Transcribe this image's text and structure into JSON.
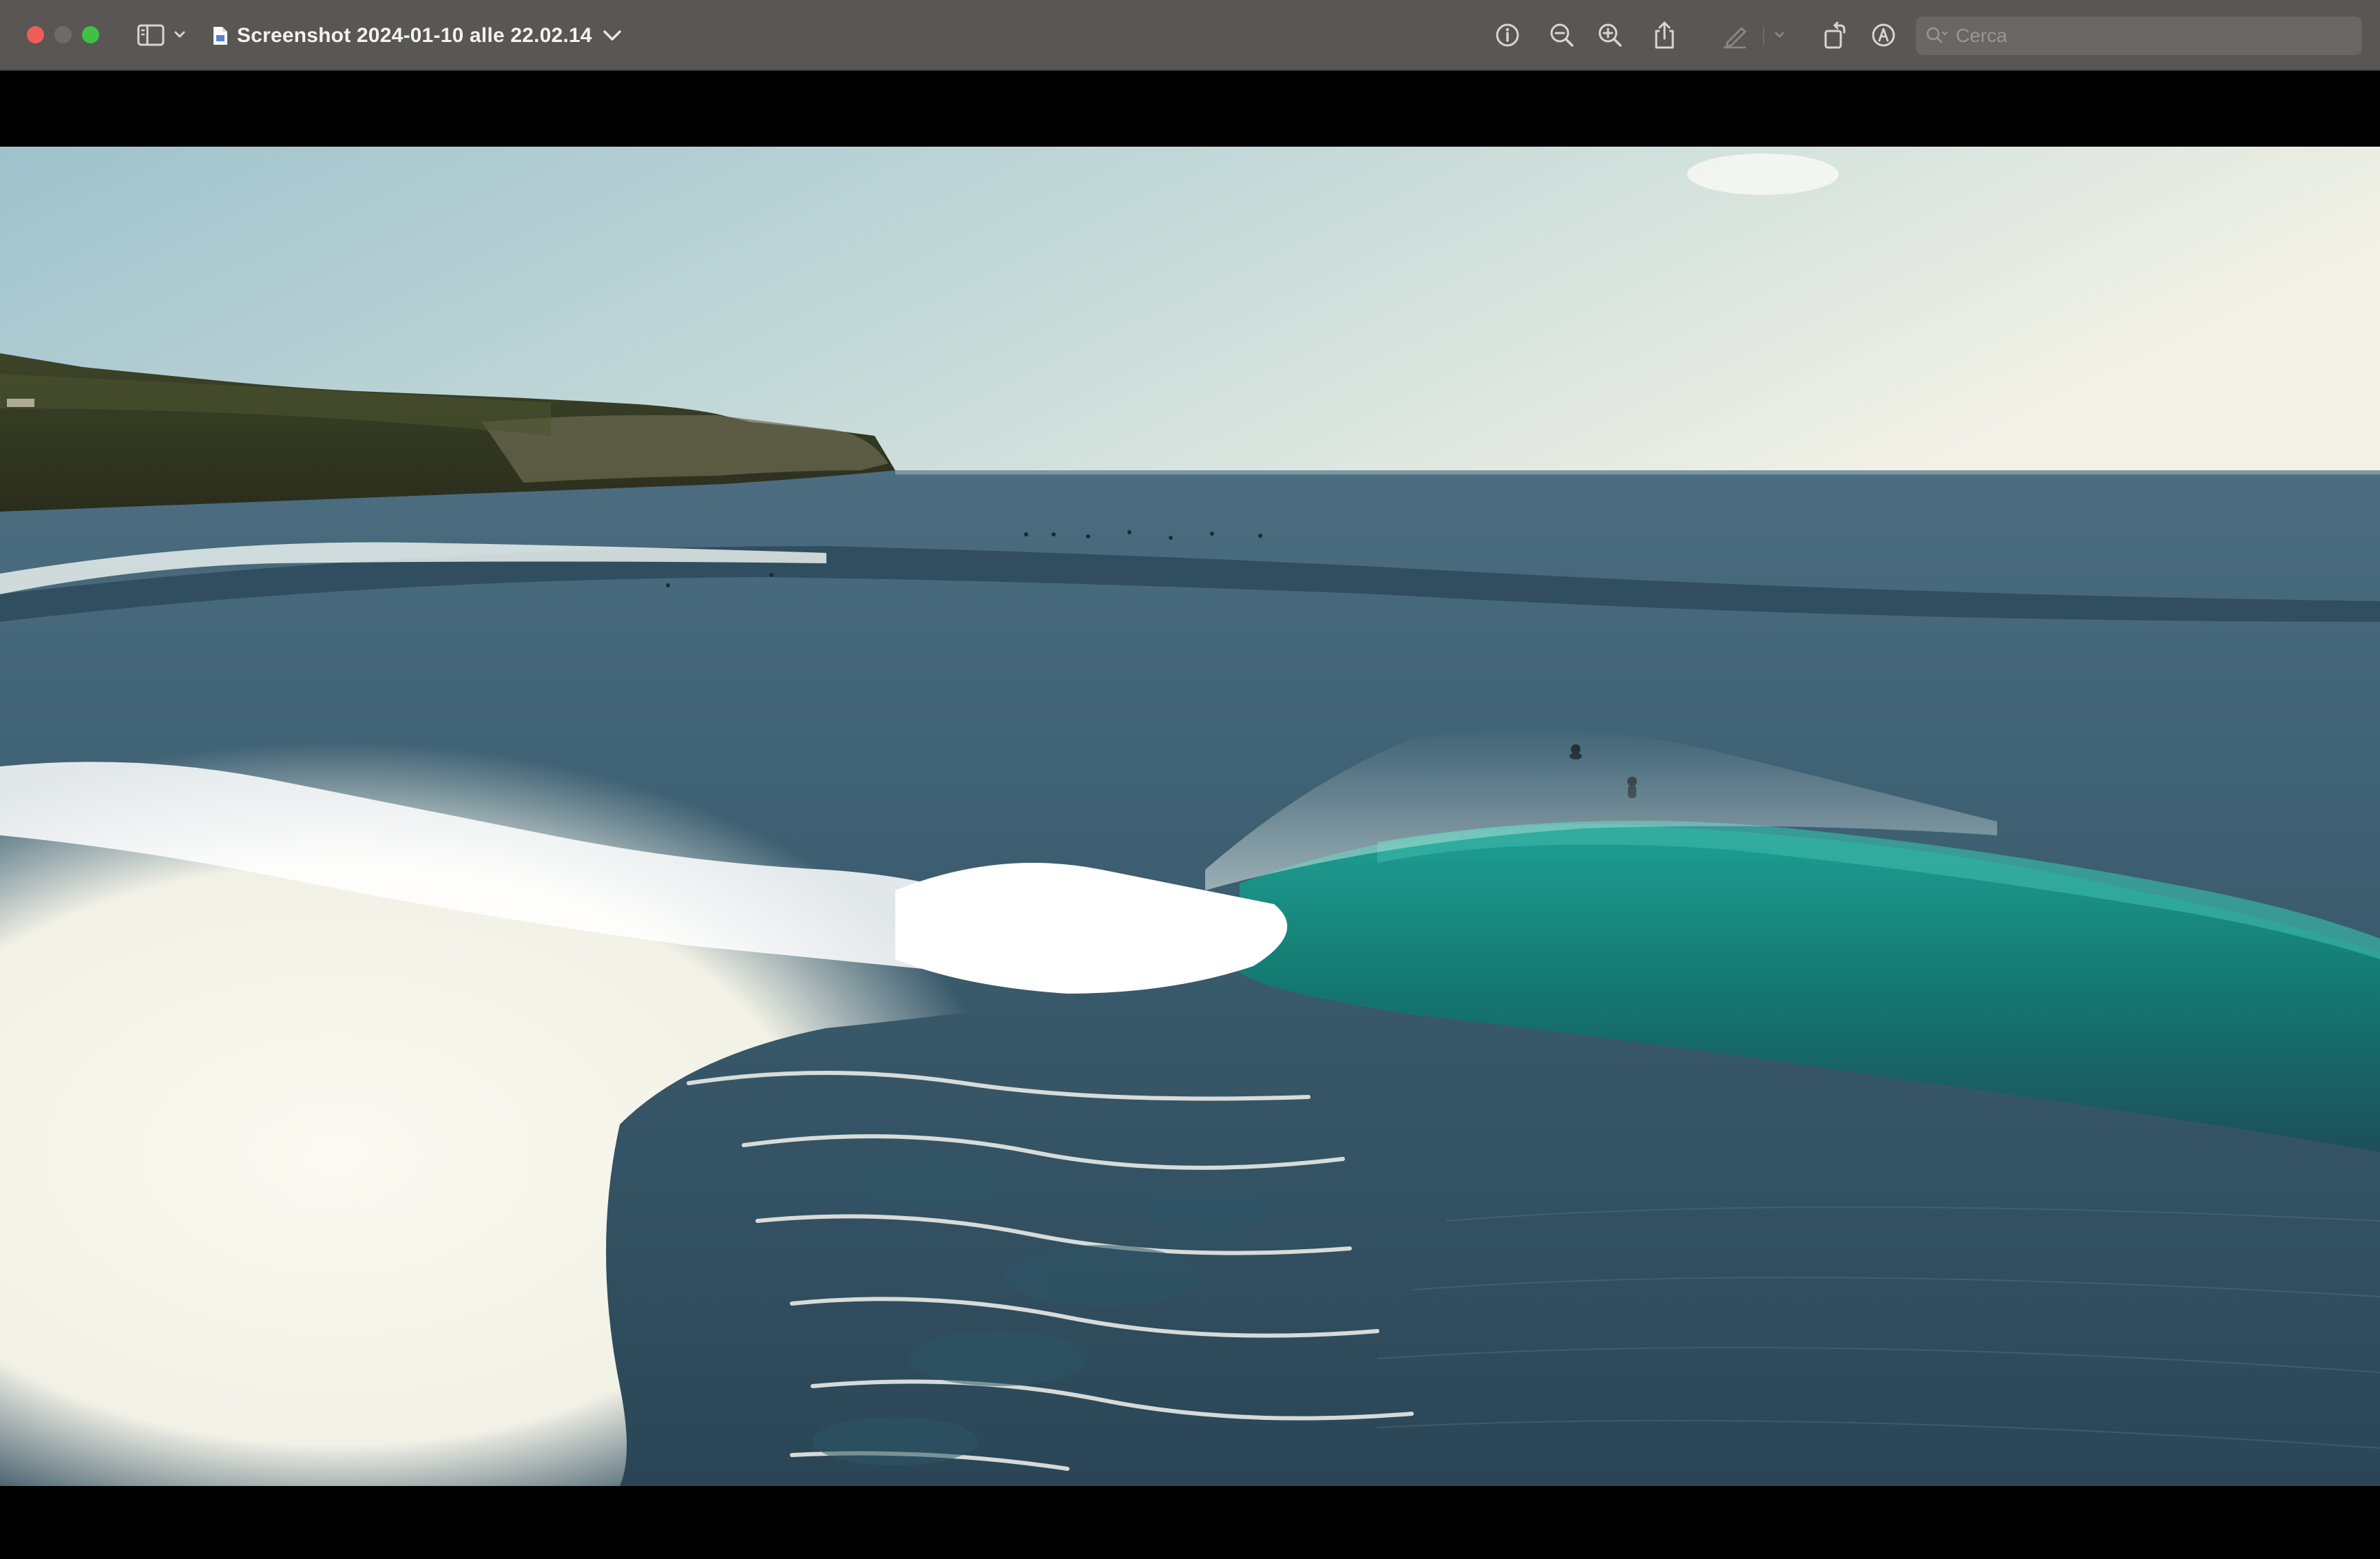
{
  "window": {
    "title": "Screenshot 2024-01-10 alle 22.02.14"
  },
  "toolbar": {
    "buttons": [
      {
        "name": "sidebar-toggle",
        "icon": "sidebar-icon"
      },
      {
        "name": "info",
        "icon": "info-icon"
      },
      {
        "name": "zoom-out",
        "icon": "zoom-out-icon"
      },
      {
        "name": "zoom-in",
        "icon": "zoom-in-icon"
      },
      {
        "name": "share",
        "icon": "share-icon"
      },
      {
        "name": "highlight",
        "icon": "highlighter-icon"
      },
      {
        "name": "rotate",
        "icon": "rotate-icon"
      },
      {
        "name": "markup",
        "icon": "markup-icon"
      }
    ]
  },
  "search": {
    "placeholder": "Cerca",
    "value": ""
  },
  "image": {
    "alt": "Aerial photograph of a turquoise ocean wave breaking near a forested coastline with surfers"
  },
  "colors": {
    "titlebar": "#5a5654",
    "close": "#ee5e57",
    "minimize": "#6f6b69",
    "zoom": "#3ec144",
    "sky": "#a9c7cf",
    "ocean": "#2f4f60",
    "wave": "#1f8c84",
    "foam": "#f7f6ee"
  }
}
